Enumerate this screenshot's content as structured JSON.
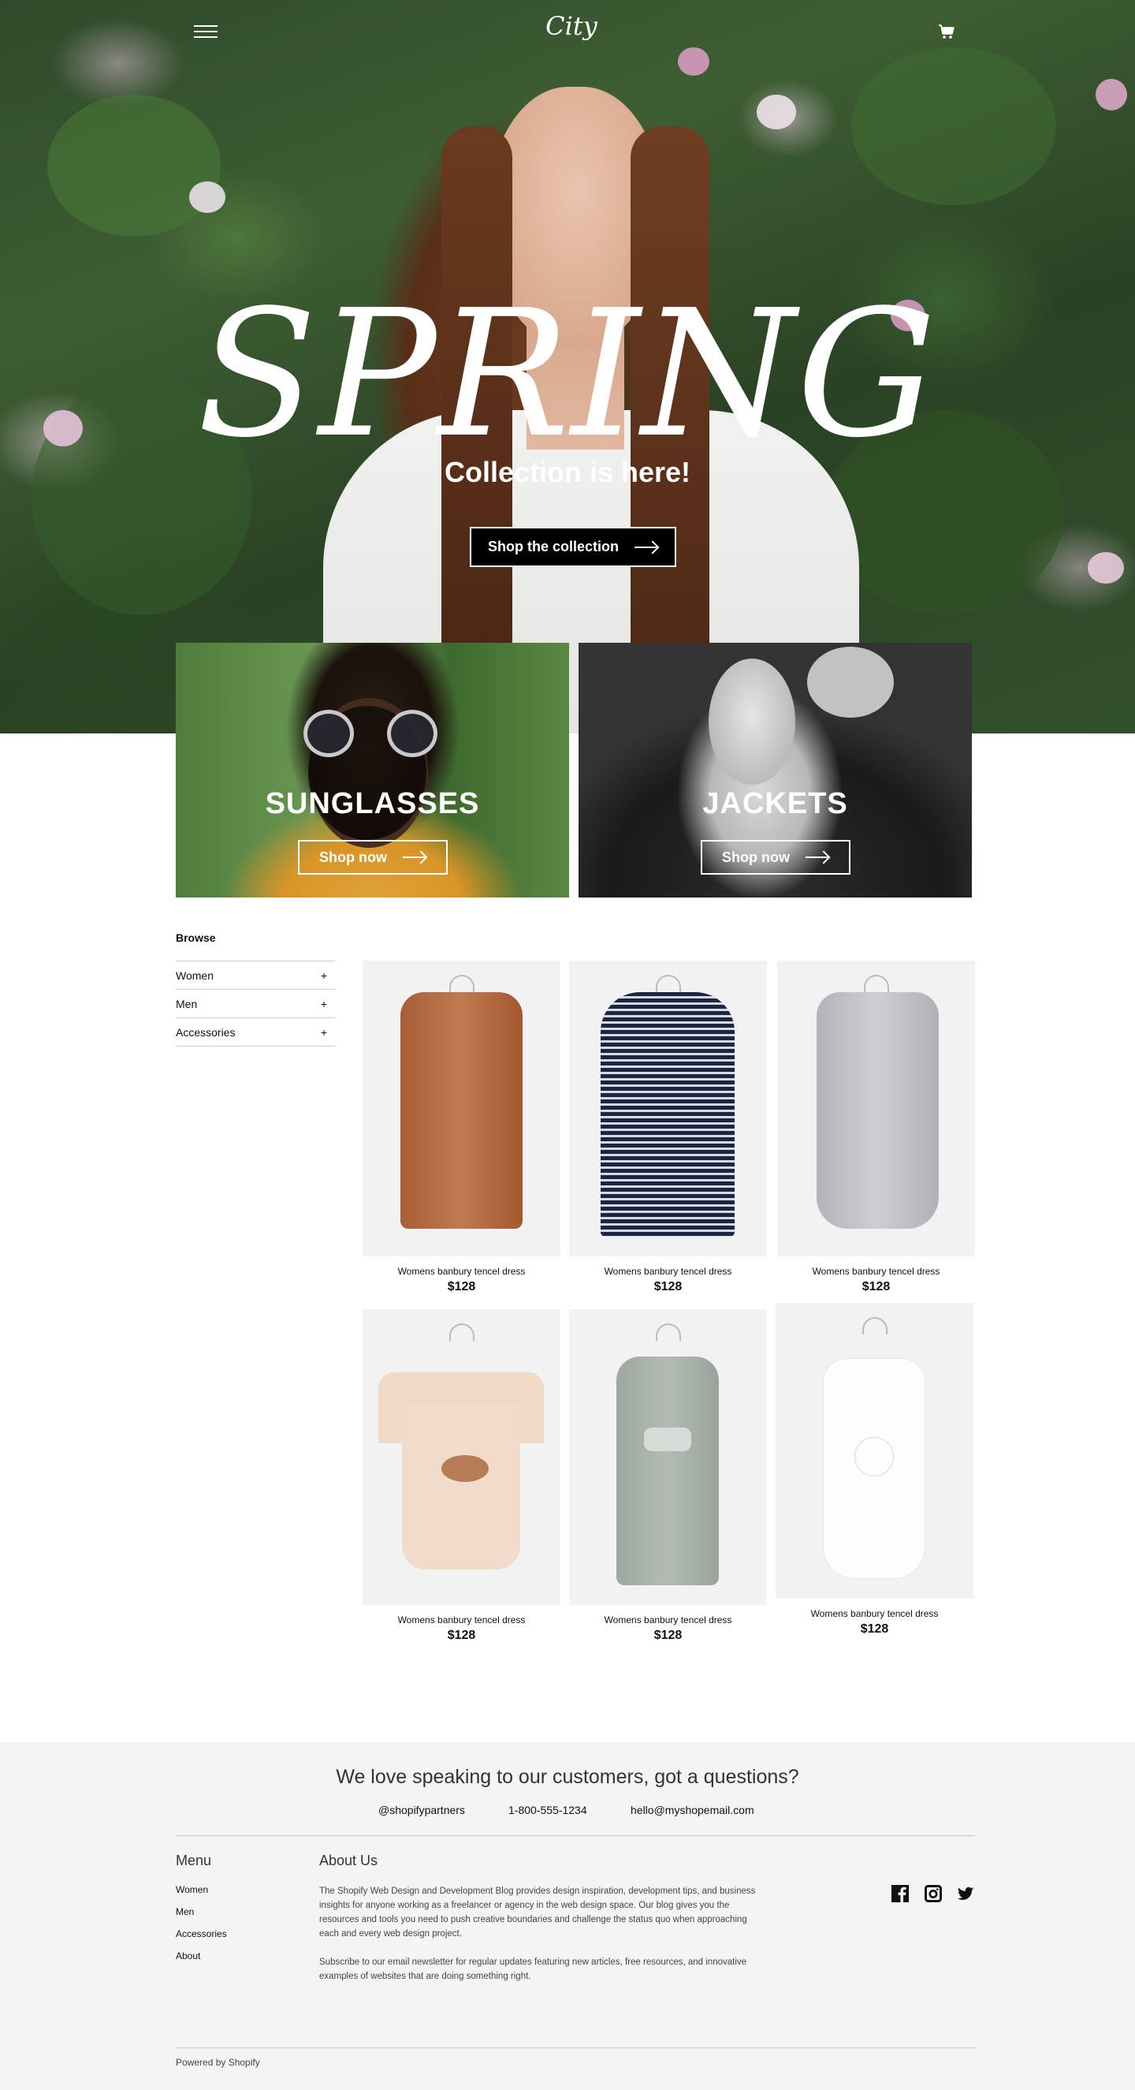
{
  "header": {
    "logo_text": "City"
  },
  "hero": {
    "title": "SPRING",
    "subtitle": "Collection is here!",
    "cta_label": "Shop the collection"
  },
  "promos": [
    {
      "title": "SUNGLASSES",
      "cta_label": "Shop now"
    },
    {
      "title": "JACKETS",
      "cta_label": "Shop now"
    }
  ],
  "browse": {
    "title": "Browse",
    "items": [
      {
        "label": "Women",
        "toggle": "+"
      },
      {
        "label": "Men",
        "toggle": "+"
      },
      {
        "label": "Accessories",
        "toggle": "+"
      }
    ]
  },
  "products": [
    {
      "name": "Womens banbury tencel dress",
      "price": "$128",
      "color": "#b87048"
    },
    {
      "name": "Womens banbury tencel dress",
      "price": "$128",
      "color": "#27304a"
    },
    {
      "name": "Womens banbury tencel dress",
      "price": "$128",
      "color": "#c3c2c8"
    },
    {
      "name": "Womens banbury tencel dress",
      "price": "$128",
      "color": "#f0dcc8"
    },
    {
      "name": "Womens banbury tencel dress",
      "price": "$128",
      "color": "#a9b1aa"
    },
    {
      "name": "Womens banbury tencel dress",
      "price": "$128",
      "color": "#fbfbfb"
    }
  ],
  "footer": {
    "headline": "We love speaking to our customers, got a questions?",
    "contacts": {
      "social": "@shopifypartners",
      "phone": "1-800-555-1234",
      "email": "hello@myshopemail.com"
    },
    "menu_title": "Menu",
    "menu_items": [
      "Women",
      "Men",
      "Accessories",
      "About"
    ],
    "about_title": "About Us",
    "about_p1": "The Shopify Web Design and Development Blog provides design inspiration, development tips, and business insights for anyone working as a freelancer or agency in the web design space. Our blog gives you the resources and tools you need to push creative boundaries and challenge the status quo when approaching each and every web design project.",
    "about_p2": "Subscribe to our email newsletter for regular updates featuring new articles, free resources, and innovative examples of websites that are doing something right.",
    "social_icons": [
      "facebook-icon",
      "instagram-icon",
      "twitter-icon"
    ],
    "powered": "Powered by Shopify"
  }
}
